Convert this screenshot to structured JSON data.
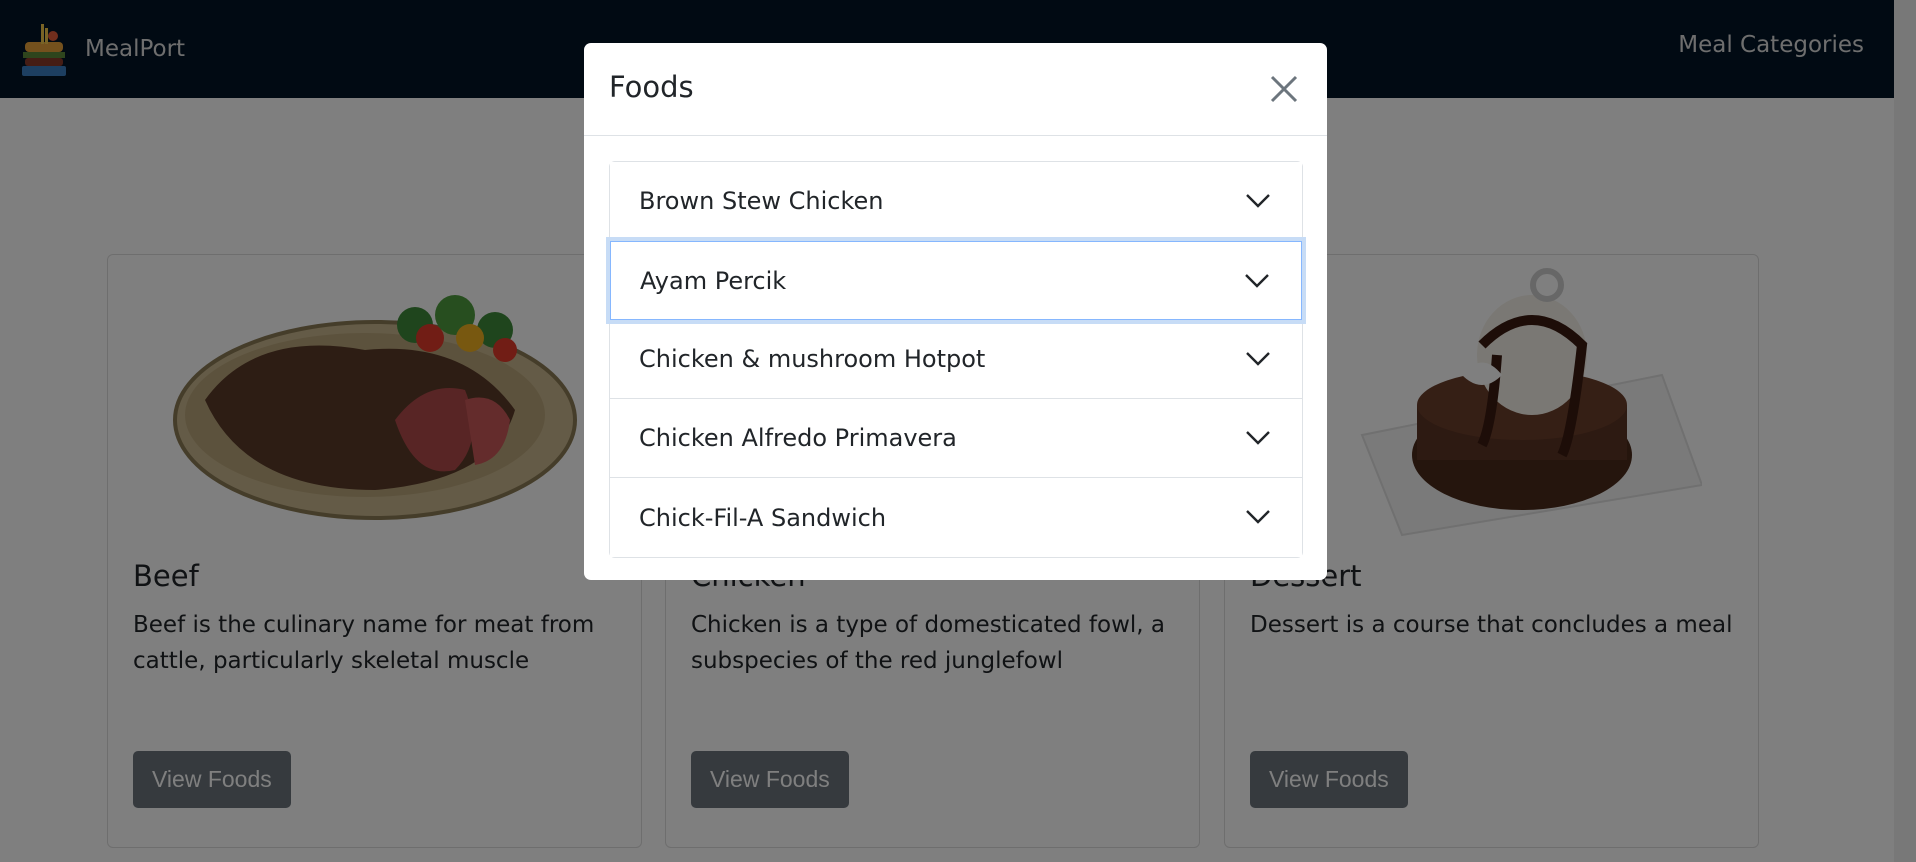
{
  "navbar": {
    "brand": "MealPort",
    "link": "Meal Categories"
  },
  "cards": [
    {
      "title": "Beef",
      "text": "Beef is the culinary name for meat from cattle, particularly skeletal muscle",
      "button": "View Foods",
      "image_icon": "steak-image"
    },
    {
      "title": "Chicken",
      "text": "Chicken is a type of domesticated fowl, a subspecies of the red junglefowl",
      "button": "View Foods",
      "image_icon": "chicken-image"
    },
    {
      "title": "Dessert",
      "text": "Dessert is a course that concludes a meal",
      "button": "View Foods",
      "image_icon": "dessert-image"
    }
  ],
  "modal": {
    "title": "Foods",
    "items": [
      {
        "label": "Brown Stew Chicken"
      },
      {
        "label": "Ayam Percik"
      },
      {
        "label": "Chicken & mushroom Hotpot"
      },
      {
        "label": "Chicken Alfredo Primavera"
      },
      {
        "label": "Chick-Fil-A Sandwich"
      }
    ]
  },
  "colors": {
    "navbar": "#021526",
    "button": "#6c757d",
    "focus_ring": "#c7dcf6"
  }
}
